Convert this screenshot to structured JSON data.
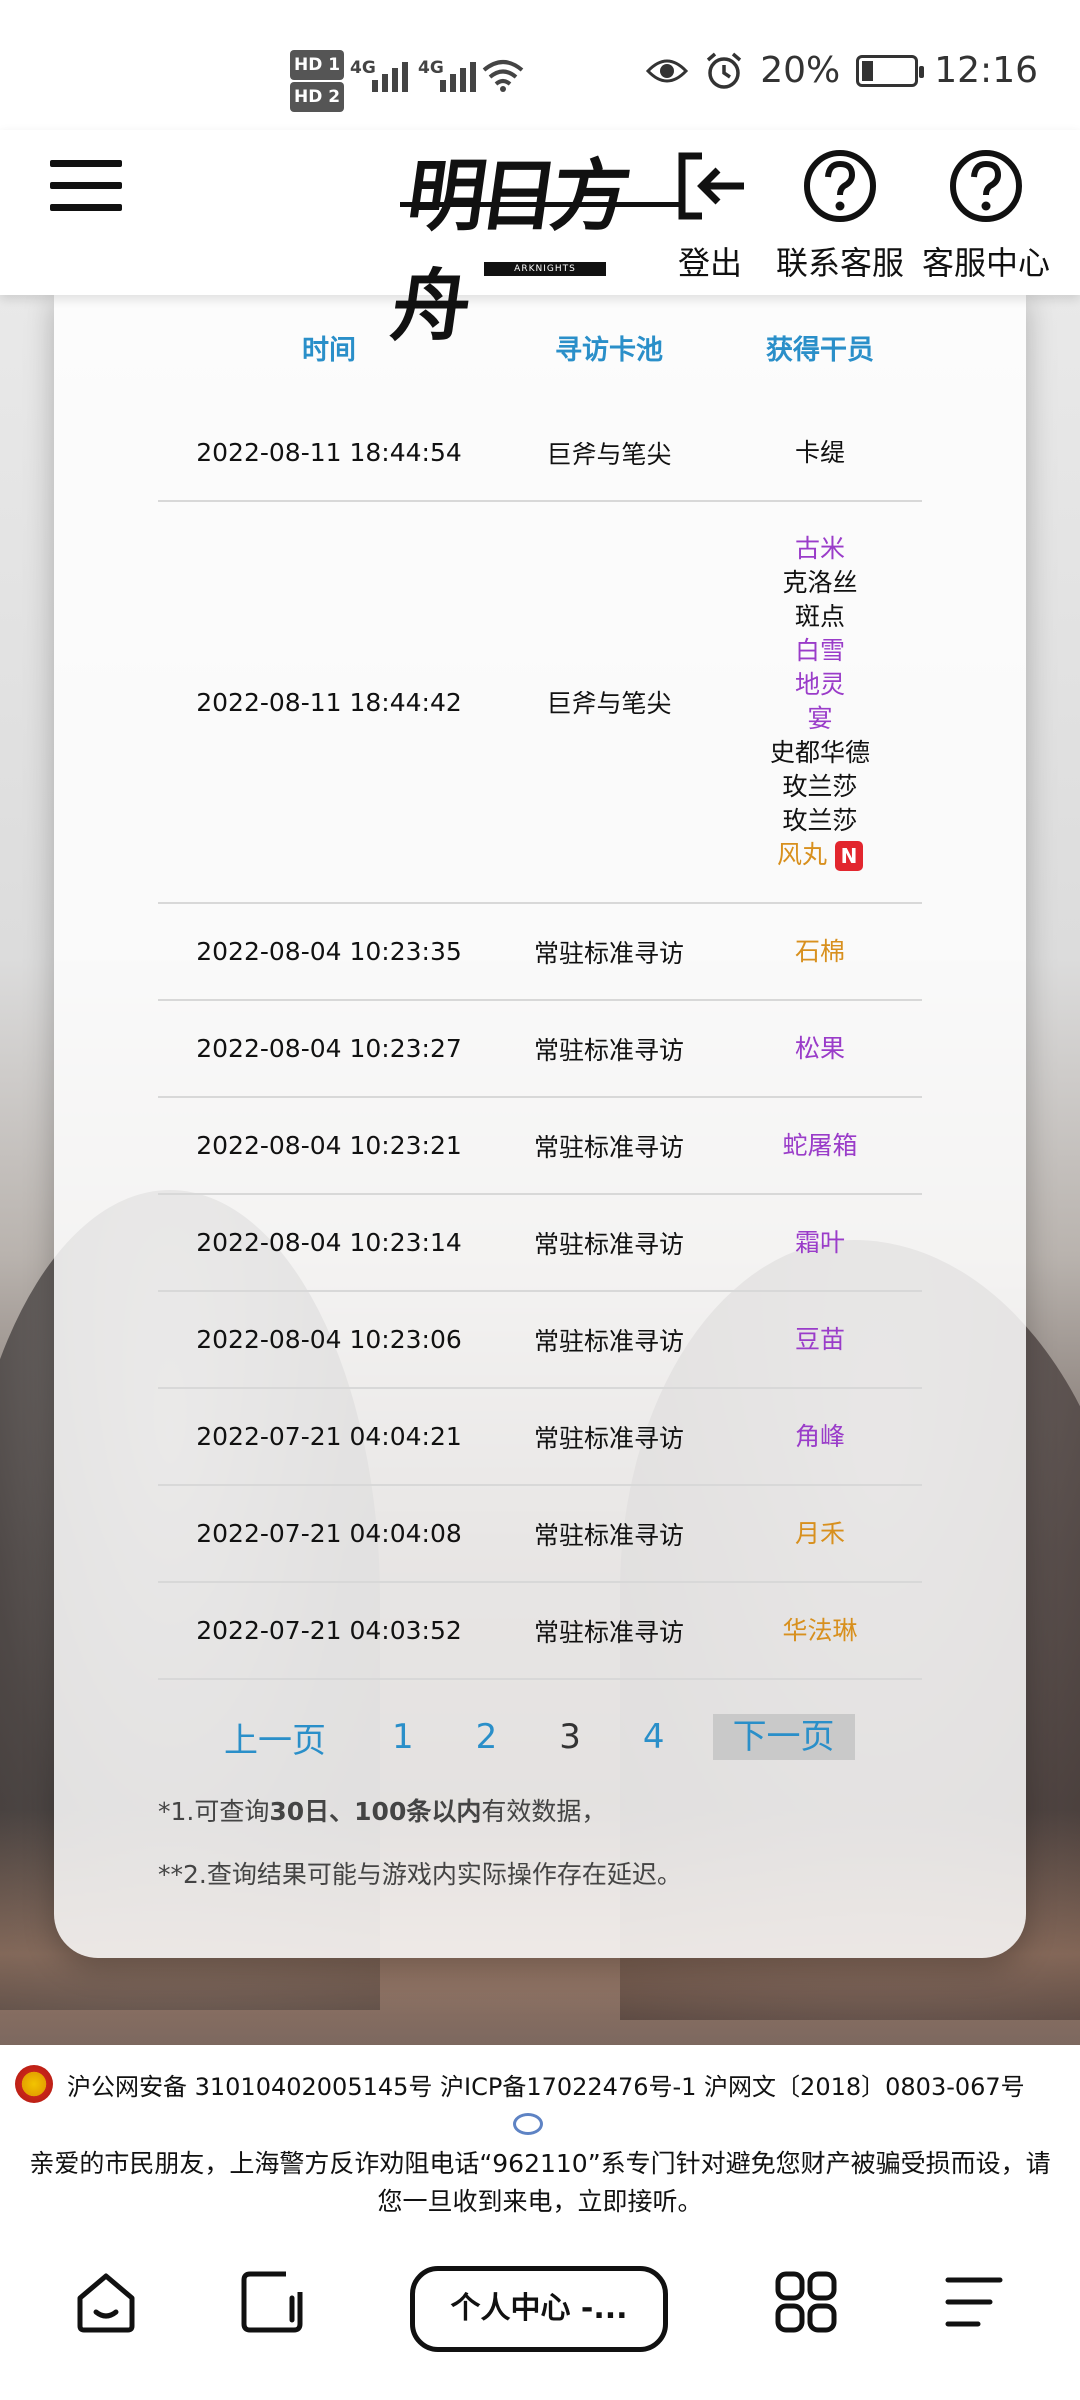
{
  "status_bar": {
    "hd1": "HD 1",
    "hd2": "HD 2",
    "net1": "4G",
    "net2": "4G",
    "battery": "20%",
    "time": "12:16"
  },
  "header": {
    "logo_text": "明日方舟",
    "logo_sub": "ARKNIGHTS",
    "logout_label": "登出",
    "contact_label": "联系客服",
    "service_center_label": "客服中心"
  },
  "table": {
    "headers": [
      "时间",
      "寻访卡池",
      "获得干员"
    ],
    "rows": [
      {
        "time": "2022-08-11 18:44:54",
        "pool": "巨斧与笔尖",
        "operators": [
          {
            "name": "卡缇",
            "rarity": "black"
          }
        ]
      },
      {
        "time": "2022-08-11 18:44:42",
        "pool": "巨斧与笔尖",
        "operators": [
          {
            "name": "古米",
            "rarity": "purple"
          },
          {
            "name": "克洛丝",
            "rarity": "black"
          },
          {
            "name": "斑点",
            "rarity": "black"
          },
          {
            "name": "白雪",
            "rarity": "purple"
          },
          {
            "name": "地灵",
            "rarity": "purple"
          },
          {
            "name": "宴",
            "rarity": "purple"
          },
          {
            "name": "史都华德",
            "rarity": "black"
          },
          {
            "name": "玫兰莎",
            "rarity": "black"
          },
          {
            "name": "玫兰莎",
            "rarity": "black"
          },
          {
            "name": "风丸",
            "rarity": "gold",
            "badge": "N"
          }
        ]
      },
      {
        "time": "2022-08-04 10:23:35",
        "pool": "常驻标准寻访",
        "operators": [
          {
            "name": "石棉",
            "rarity": "gold"
          }
        ]
      },
      {
        "time": "2022-08-04 10:23:27",
        "pool": "常驻标准寻访",
        "operators": [
          {
            "name": "松果",
            "rarity": "purple"
          }
        ]
      },
      {
        "time": "2022-08-04 10:23:21",
        "pool": "常驻标准寻访",
        "operators": [
          {
            "name": "蛇屠箱",
            "rarity": "purple"
          }
        ]
      },
      {
        "time": "2022-08-04 10:23:14",
        "pool": "常驻标准寻访",
        "operators": [
          {
            "name": "霜叶",
            "rarity": "purple"
          }
        ]
      },
      {
        "time": "2022-08-04 10:23:06",
        "pool": "常驻标准寻访",
        "operators": [
          {
            "name": "豆苗",
            "rarity": "purple"
          }
        ]
      },
      {
        "time": "2022-07-21 04:04:21",
        "pool": "常驻标准寻访",
        "operators": [
          {
            "name": "角峰",
            "rarity": "purple"
          }
        ]
      },
      {
        "time": "2022-07-21 04:04:08",
        "pool": "常驻标准寻访",
        "operators": [
          {
            "name": "月禾",
            "rarity": "gold"
          }
        ]
      },
      {
        "time": "2022-07-21 04:03:52",
        "pool": "常驻标准寻访",
        "operators": [
          {
            "name": "华法琳",
            "rarity": "gold"
          }
        ]
      }
    ]
  },
  "pager": {
    "prev": "上一页",
    "pages": [
      "1",
      "2",
      "3",
      "4"
    ],
    "current": "3",
    "next": "下一页"
  },
  "notes": {
    "note1_prefix": "*1.可查询",
    "note1_bold": "30日、100条以内",
    "note1_suffix": "有效数据，",
    "note2": "**2.查询结果可能与游戏内实际操作存在延迟。"
  },
  "footer": {
    "beian": "沪公网安备 31010402005145号  沪ICP备17022476号-1  沪网文〔2018〕0803-067号",
    "notice_line1": "亲爱的市民朋友，上海警方反诈劝阻电话“962110”系专门针对避免您财产被骗受损而设，请",
    "notice_line2": "您一旦收到来电，立即接听。"
  },
  "browser_bar": {
    "tab_label": "个人中心 -..."
  },
  "colors": {
    "accent": "#2a8fc9",
    "rarity_purple": "#9a3cc9",
    "rarity_gold": "#d8901e",
    "new_badge": "#e2262e"
  }
}
